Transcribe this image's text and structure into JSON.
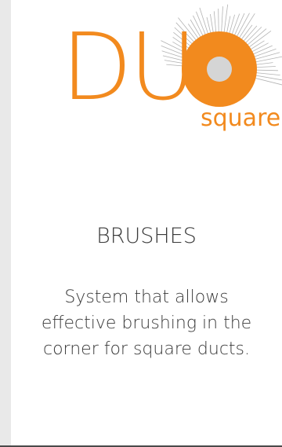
{
  "logo": {
    "word": "DU",
    "sub": "square",
    "accent_color": "#f28a1e",
    "dot_color": "#d5d5d5",
    "brush_color": "#b3b3b3",
    "icon": "brush-bristles-icon"
  },
  "content": {
    "title": "BRUSHES",
    "description": "System that allows effective brushing in the corner for square ducts."
  },
  "colors": {
    "sidebar": "#e9e9e9",
    "text": "#3a3a3a",
    "background": "#ffffff"
  }
}
